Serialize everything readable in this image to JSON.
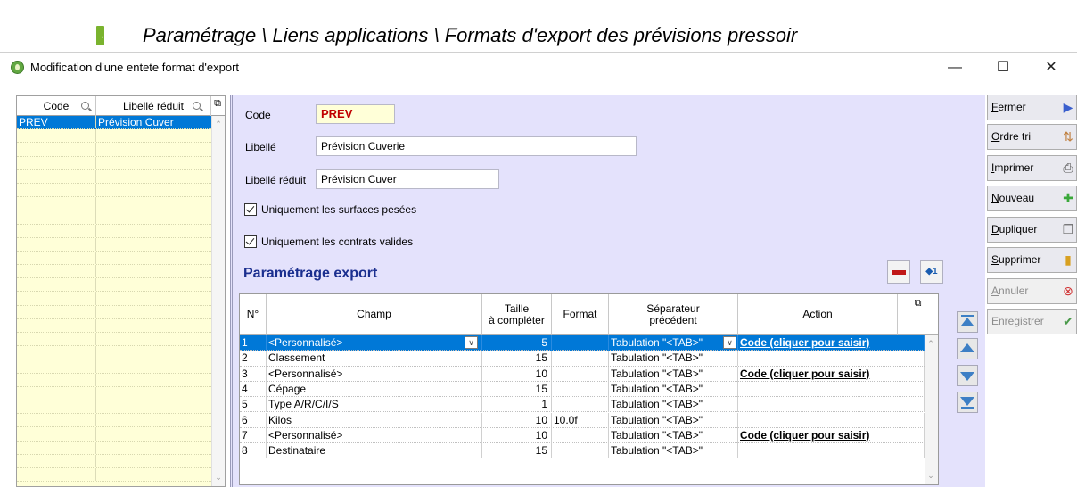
{
  "document": {
    "title": "Paramétrage \\ Liens applications \\ Formats d'export des prévisions pressoir",
    "marker_glyph": "→"
  },
  "window": {
    "title": "Modification d'une entete format d'export",
    "minimize_glyph": "—",
    "maximize_glyph": "☐",
    "close_glyph": "✕"
  },
  "list": {
    "columns": [
      "Code",
      "Libellé réduit"
    ],
    "rows": [
      {
        "code": "PREV",
        "label": "Prévision Cuver",
        "selected": true
      }
    ]
  },
  "form": {
    "code_label": "Code",
    "code_value": "PREV",
    "libelle_label": "Libellé",
    "libelle_value": "Prévision Cuverie",
    "libelle_reduit_label": "Libellé réduit",
    "libelle_reduit_value": "Prévision Cuver",
    "chk_surfaces_label": "Uniquement les surfaces pesées",
    "chk_surfaces_checked": true,
    "chk_contrats_label": "Uniquement les contrats valides",
    "chk_contrats_checked": true,
    "section_title": "Paramétrage export",
    "insert_btn_label": "◆1"
  },
  "grid": {
    "headers": {
      "num": "N°",
      "champ": "Champ",
      "taille_1": "Taille",
      "taille_2": "à compléter",
      "format": "Format",
      "sep_1": "Séparateur",
      "sep_2": "précédent",
      "action": "Action"
    },
    "rows": [
      {
        "n": "1",
        "champ": "<Personnalisé>",
        "taille": "5",
        "format": "",
        "sep": "Tabulation \"<TAB>\"",
        "action": "Code (cliquer pour saisir)",
        "selected": true
      },
      {
        "n": "2",
        "champ": "Classement",
        "taille": "15",
        "format": "",
        "sep": "Tabulation \"<TAB>\"",
        "action": ""
      },
      {
        "n": "3",
        "champ": "<Personnalisé>",
        "taille": "10",
        "format": "",
        "sep": "Tabulation \"<TAB>\"",
        "action": "Code (cliquer pour saisir)"
      },
      {
        "n": "4",
        "champ": "Cépage",
        "taille": "15",
        "format": "",
        "sep": "Tabulation \"<TAB>\"",
        "action": ""
      },
      {
        "n": "5",
        "champ": "Type A/R/C/I/S",
        "taille": "1",
        "format": "",
        "sep": "Tabulation \"<TAB>\"",
        "action": ""
      },
      {
        "n": "6",
        "champ": "Kilos",
        "taille": "10",
        "format": "10.0f",
        "sep": "Tabulation \"<TAB>\"",
        "action": ""
      },
      {
        "n": "7",
        "champ": "<Personnalisé>",
        "taille": "10",
        "format": "",
        "sep": "Tabulation \"<TAB>\"",
        "action": "Code (cliquer pour saisir)"
      },
      {
        "n": "8",
        "champ": "Destinataire",
        "taille": "15",
        "format": "",
        "sep": "Tabulation \"<TAB>\"",
        "action": ""
      }
    ]
  },
  "buttons": [
    {
      "key": "fermer",
      "first": "F",
      "rest": "ermer",
      "icon": "door-exit-icon",
      "glyph": "▶",
      "color": "#3a5fcd",
      "enabled": true
    },
    {
      "key": "ordre_tri",
      "first": "O",
      "rest": "rdre tri",
      "icon": "sort-icon",
      "glyph": "⇅",
      "color": "#c08040",
      "enabled": true
    },
    {
      "key": "imprimer",
      "first": "I",
      "rest": "mprimer",
      "icon": "printer-icon",
      "glyph": "⎙",
      "color": "#555555",
      "enabled": true
    },
    {
      "key": "nouveau",
      "first": "N",
      "rest": "ouveau",
      "icon": "plus-icon",
      "glyph": "✚",
      "color": "#3aa83a",
      "enabled": true
    },
    {
      "key": "dupliquer",
      "first": "D",
      "rest": "upliquer",
      "icon": "duplicate-icon",
      "glyph": "❐",
      "color": "#6a6a6a",
      "enabled": true
    },
    {
      "key": "supprimer",
      "first": "S",
      "rest": "upprimer",
      "icon": "trash-icon",
      "glyph": "▮",
      "color": "#d8a020",
      "enabled": true
    },
    {
      "key": "annuler",
      "first": "A",
      "rest": "nnuler",
      "icon": "cancel-icon",
      "glyph": "⊗",
      "color": "#d03030",
      "enabled": false
    },
    {
      "key": "enregistrer",
      "first": "",
      "rest": "Enregistrer",
      "icon": "check-icon",
      "glyph": "✔",
      "color": "#4a9a4a",
      "enabled": false
    }
  ]
}
